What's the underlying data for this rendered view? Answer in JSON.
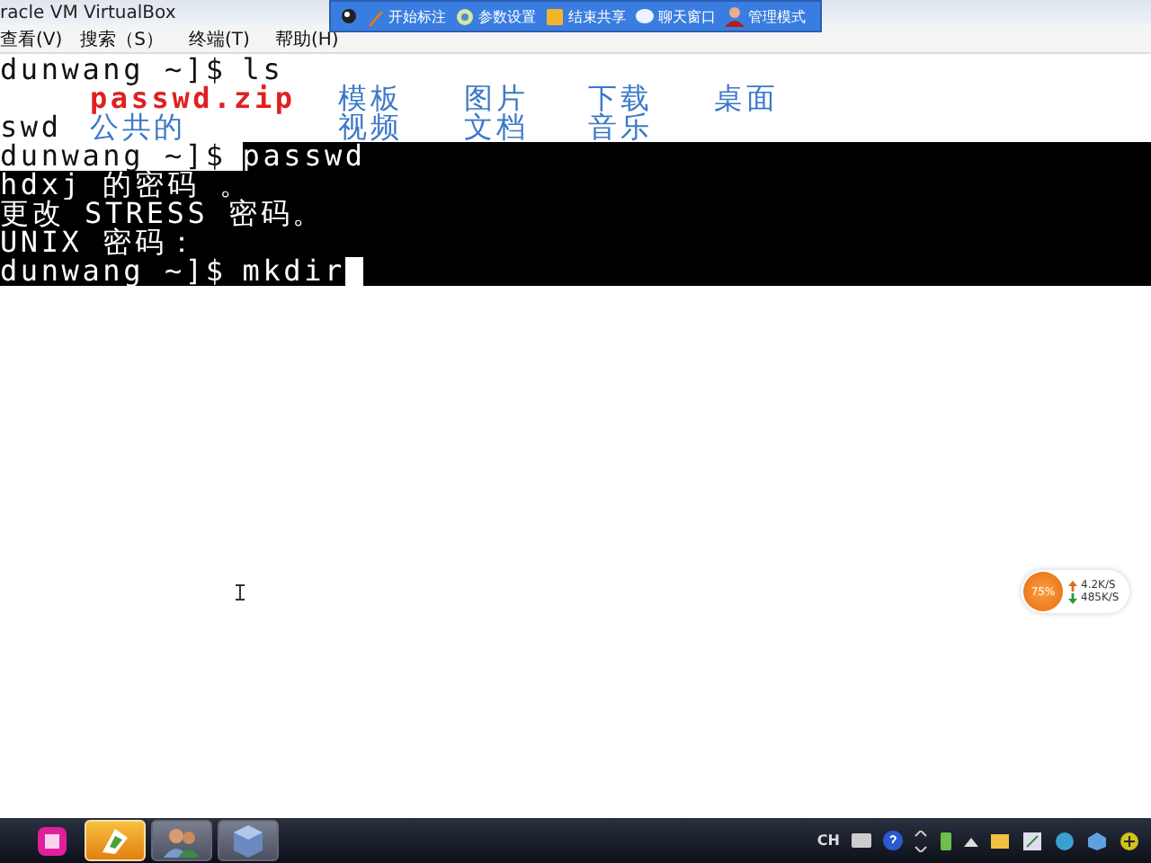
{
  "window": {
    "title": "racle VM VirtualBox"
  },
  "share_toolbar": {
    "items": [
      {
        "label": "开始标注",
        "kind": "pen"
      },
      {
        "label": "参数设置",
        "kind": "settings"
      },
      {
        "label": "结束共享",
        "kind": "stop"
      },
      {
        "label": "聊天窗口",
        "kind": "chat"
      },
      {
        "label": "管理模式",
        "kind": "user"
      }
    ]
  },
  "menu": [
    "查看(V)",
    "搜索（S）",
    "终端(T)",
    "帮助(H)"
  ],
  "terminal": {
    "lines": [
      {
        "kind": "prompt",
        "prompt": "dunwang ~]$",
        "command": "ls",
        "prompt_highlighted": false,
        "command_highlighted": false,
        "cursor": false
      },
      {
        "kind": "listing",
        "entries": [
          {
            "name": "passwd.zip",
            "kind": "archive"
          },
          {
            "name": "模板",
            "kind": "directory"
          },
          {
            "name": "图片",
            "kind": "directory"
          },
          {
            "name": "下载",
            "kind": "directory"
          },
          {
            "name": "桌面",
            "kind": "directory"
          },
          {
            "name": "swd",
            "kind": "file"
          },
          {
            "name": "公共的",
            "kind": "directory"
          },
          {
            "name": "视频",
            "kind": "directory"
          },
          {
            "name": "文档",
            "kind": "directory"
          },
          {
            "name": "音乐",
            "kind": "directory"
          }
        ]
      },
      {
        "kind": "prompt",
        "prompt": "dunwang ~]$",
        "command": "passwd",
        "prompt_highlighted": false,
        "command_highlighted": true,
        "cursor": false
      },
      {
        "kind": "output",
        "text": "hdxj 的密码 。",
        "highlighted": true
      },
      {
        "kind": "output",
        "text": "更改 STRESS 密码。",
        "highlighted": true
      },
      {
        "kind": "output",
        "text": "UNIX 密码：",
        "highlighted": true
      },
      {
        "kind": "prompt",
        "prompt": "dunwang ~]$",
        "command": "mkdir",
        "prompt_highlighted": true,
        "command_highlighted": true,
        "cursor": true
      }
    ]
  },
  "network_meter": {
    "percent": "75%",
    "upload": "4.2K/S",
    "download": "485K/S"
  },
  "taskbar": {
    "apps": [
      {
        "kind": "magenta",
        "selected": false
      },
      {
        "kind": "folder",
        "selected": true
      },
      {
        "kind": "people",
        "selected": false
      },
      {
        "kind": "cube",
        "selected": false
      }
    ],
    "language": "CH"
  }
}
